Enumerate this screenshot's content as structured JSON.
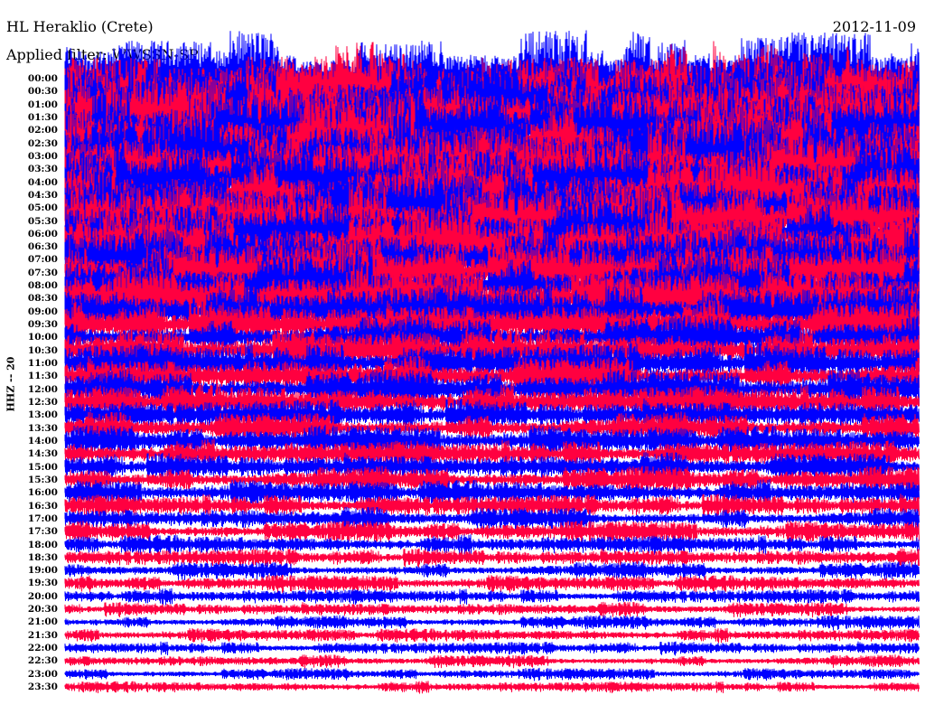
{
  "header": {
    "station": "HL Heraklio (Crete)",
    "date": "2012-11-09",
    "filter": "Applied filter: WWSSN-SP"
  },
  "chart_data": {
    "type": "line",
    "title": "HL Heraklio (Crete)",
    "subtitle": "Applied filter: WWSSN-SP",
    "date": "2012-11-09",
    "ylabel": "HHZ -- 20",
    "row_labels": [
      "00:00",
      "00:30",
      "01:00",
      "01:30",
      "02:00",
      "02:30",
      "03:00",
      "03:30",
      "04:00",
      "04:30",
      "05:00",
      "05:30",
      "06:00",
      "06:30",
      "07:00",
      "07:30",
      "08:00",
      "08:30",
      "09:00",
      "09:30",
      "10:00",
      "10:30",
      "11:00",
      "11:30",
      "12:00",
      "12:30",
      "13:00",
      "13:30",
      "14:00",
      "14:30",
      "15:00",
      "15:30",
      "16:00",
      "16:30",
      "17:00",
      "17:30",
      "18:00",
      "18:30",
      "19:00",
      "19:30",
      "20:00",
      "20:30",
      "21:00",
      "21:30",
      "22:00",
      "22:30",
      "23:00",
      "23:30"
    ],
    "series_colors": {
      "full_hour": "#0000ff",
      "half_hour": "#ff0040"
    },
    "relative_amplitude": [
      1.0,
      1.0,
      1.0,
      1.0,
      1.0,
      1.0,
      0.95,
      0.95,
      0.9,
      0.9,
      0.85,
      0.85,
      0.8,
      0.8,
      0.75,
      0.75,
      0.7,
      0.65,
      0.6,
      0.5,
      0.45,
      0.45,
      0.45,
      0.42,
      0.4,
      0.38,
      0.35,
      0.33,
      0.32,
      0.3,
      0.3,
      0.28,
      0.27,
      0.25,
      0.24,
      0.22,
      0.2,
      0.19,
      0.18,
      0.17,
      0.16,
      0.15,
      0.14,
      0.14,
      0.14,
      0.13,
      0.12,
      0.12
    ],
    "grid": false
  }
}
